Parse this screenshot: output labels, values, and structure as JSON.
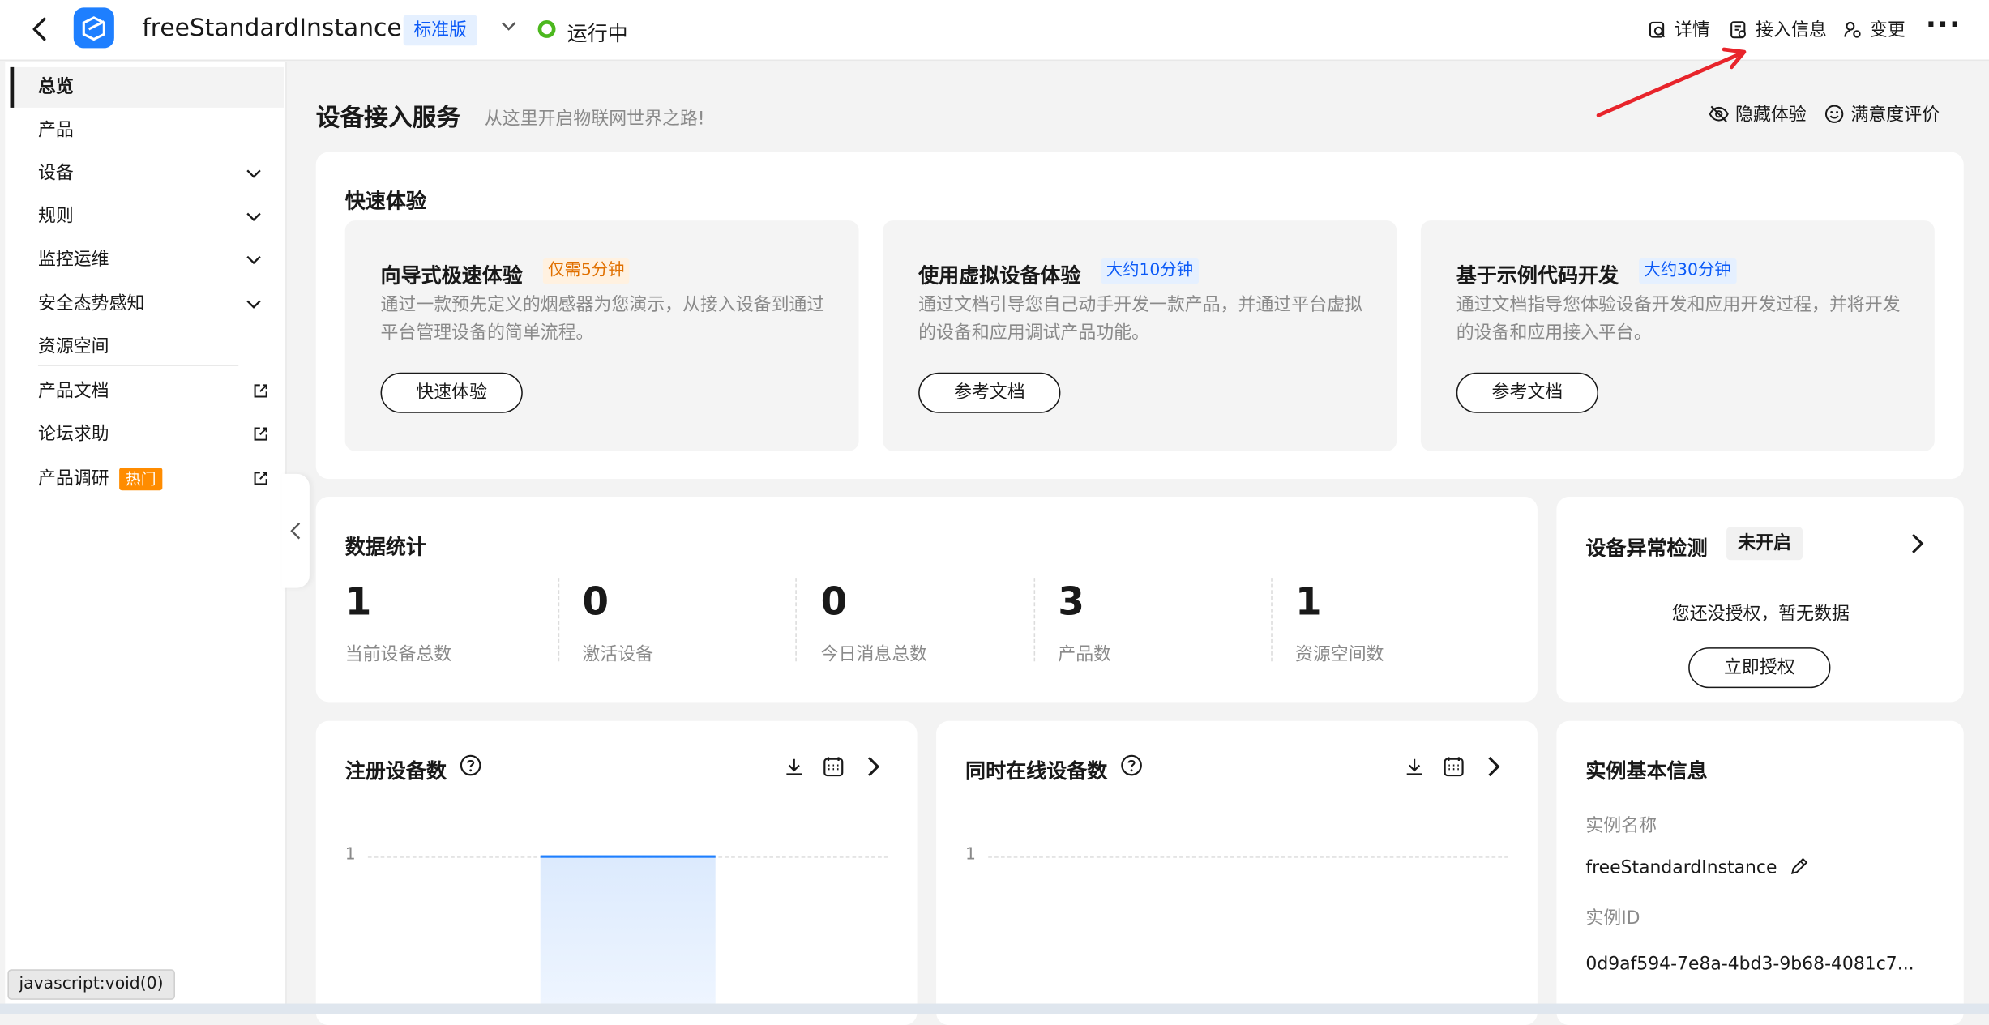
{
  "header": {
    "instance_name": "freeStandardInstance",
    "edition": "标准版",
    "status": "运行中",
    "status_color": "#4cb81e",
    "actions": [
      {
        "label": "详情",
        "icon": "details-icon"
      },
      {
        "label": "接入信息",
        "icon": "access-info-icon"
      },
      {
        "label": "变更",
        "icon": "change-icon"
      }
    ],
    "more": "···"
  },
  "sidebar": {
    "items": [
      {
        "label": "总览"
      },
      {
        "label": "产品"
      },
      {
        "label": "设备"
      },
      {
        "label": "规则"
      },
      {
        "label": "监控运维"
      },
      {
        "label": "安全态势感知"
      },
      {
        "label": "资源空间"
      },
      {
        "label": "产品文档"
      },
      {
        "label": "论坛求助"
      },
      {
        "label": "产品调研",
        "badge": "热门"
      }
    ]
  },
  "page": {
    "title": "设备接入服务",
    "subtitle": "从这里开启物联网世界之路!",
    "hide_label": "隐藏体验",
    "rating_label": "满意度评价"
  },
  "quick_start": {
    "title": "快速体验",
    "cards": [
      {
        "title": "向导式极速体验",
        "tag": "仅需5分钟",
        "desc": "通过一款预先定义的烟感器为您演示，从接入设备到通过平台管理设备的简单流程。",
        "button": "快速体验"
      },
      {
        "title": "使用虚拟设备体验",
        "tag": "大约10分钟",
        "desc": "通过文档引导您自己动手开发一款产品，并通过平台虚拟的设备和应用调试产品功能。",
        "button": "参考文档"
      },
      {
        "title": "基于示例代码开发",
        "tag": "大约30分钟",
        "desc": "通过文档指导您体验设备开发和应用开发过程，并将开发的设备和应用接入平台。",
        "button": "参考文档"
      }
    ]
  },
  "stats": {
    "title": "数据统计",
    "items": [
      {
        "value": "1",
        "label": "当前设备总数"
      },
      {
        "value": "0",
        "label": "激活设备"
      },
      {
        "value": "0",
        "label": "今日消息总数"
      },
      {
        "value": "3",
        "label": "产品数"
      },
      {
        "value": "1",
        "label": "资源空间数"
      }
    ]
  },
  "anomaly": {
    "title": "设备异常检测",
    "badge": "未开启",
    "message": "您还没授权，暂无数据",
    "button": "立即授权"
  },
  "registered_chart": {
    "title": "注册设备数",
    "y_tick": "1"
  },
  "online_chart": {
    "title": "同时在线设备数",
    "y_tick": "1"
  },
  "chart_data": [
    {
      "type": "bar",
      "title": "注册设备数",
      "values": [
        1
      ],
      "ylim": [
        0,
        1
      ]
    },
    {
      "type": "line",
      "title": "同时在线设备数",
      "values": [],
      "ylim": [
        0,
        1
      ]
    }
  ],
  "instance_info": {
    "title": "实例基本信息",
    "name_label": "实例名称",
    "name_value": "freeStandardInstance",
    "id_label": "实例ID",
    "id_value": "0d9af594-7e8a-4bd3-9b68-4081c7..."
  },
  "browser_status": "javascript:void(0)",
  "colors": {
    "accent": "#0a59f7",
    "brand": "#1e7fff",
    "hot": "#ff8c00",
    "annotation_arrow": "#e8242b"
  }
}
